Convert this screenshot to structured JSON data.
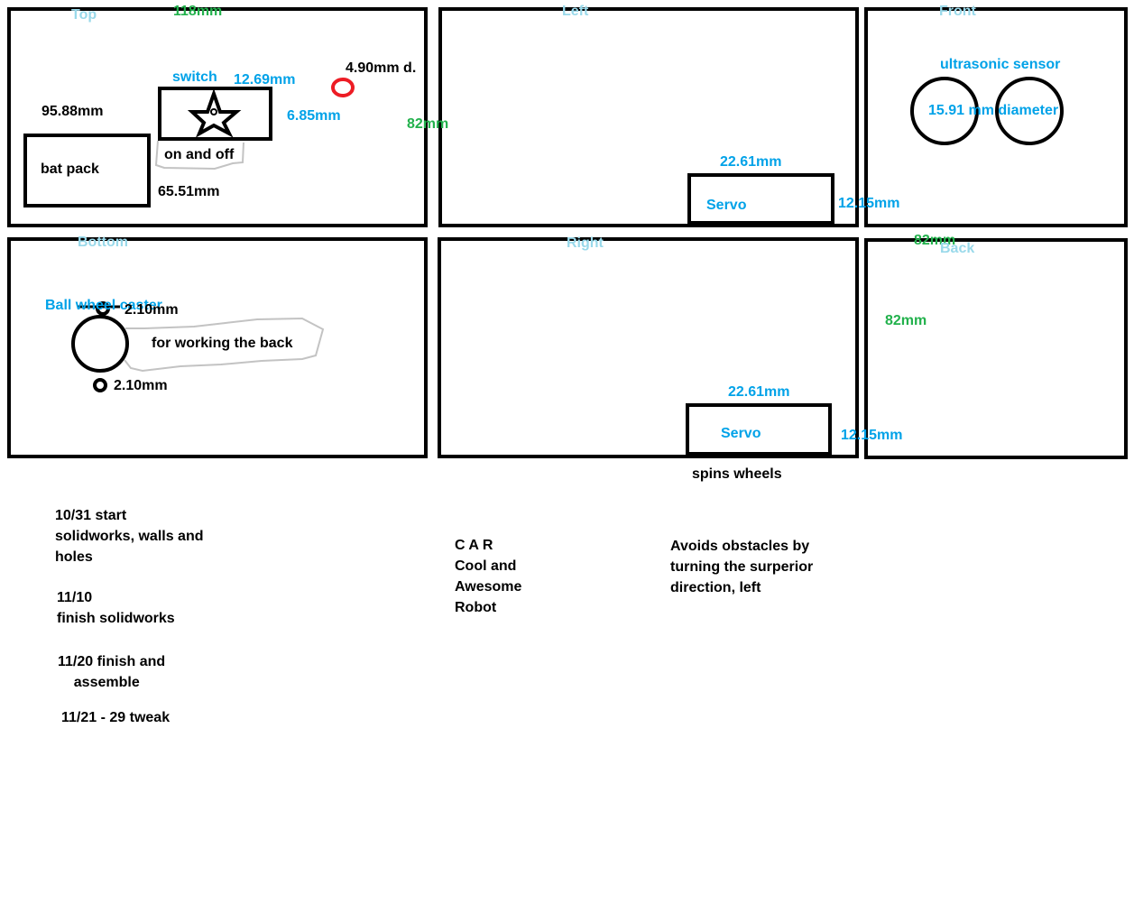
{
  "colors": {
    "outline": "#000000",
    "label": "#00a2e8",
    "view_title": "#99d9ea",
    "dimension": "#22b14c",
    "hole": "#ed1c24",
    "callout": "#c3c3c3"
  },
  "views": {
    "top": {
      "title": "Top",
      "width": "118mm",
      "height": "82mm",
      "switch_label": "switch",
      "switch_width": "12.69mm",
      "switch_height": "6.85mm",
      "switch_note": "on and off",
      "hole_diameter": "4.90mm d.",
      "battery_label": "bat pack",
      "battery_width": "65.51mm",
      "battery_height": "95.88mm"
    },
    "left": {
      "title": "Left",
      "servo_label": "Servo",
      "servo_width": "22.61mm",
      "servo_height": "12.15mm"
    },
    "front": {
      "title": "Front",
      "sensor_label": "ultrasonic sensor",
      "sensor_diameter": "15.91 mm diameter"
    },
    "bottom": {
      "title": "Bottom",
      "caster_label": "Ball wheel caster",
      "hole_top": "2.10mm",
      "hole_bottom": "2.10mm",
      "caster_note": "for working the back"
    },
    "right": {
      "title": "Right",
      "servo_label": "Servo",
      "servo_width": "22.61mm",
      "servo_height": "12.15mm",
      "servo_note": "spins wheels"
    },
    "back": {
      "title": "Back",
      "width": "82mm",
      "height": "82mm"
    }
  },
  "notes": {
    "schedule": [
      "10/31 start\nsolidworks, walls and\nholes",
      "11/10\nfinish solidworks",
      "11/20 finish and\n    assemble",
      "11/21 - 29 tweak"
    ],
    "acronym": "C A R\nCool and\nAwesome\nRobot",
    "behavior": "Avoids obstacles by\nturning the surperior\ndirection, left"
  }
}
